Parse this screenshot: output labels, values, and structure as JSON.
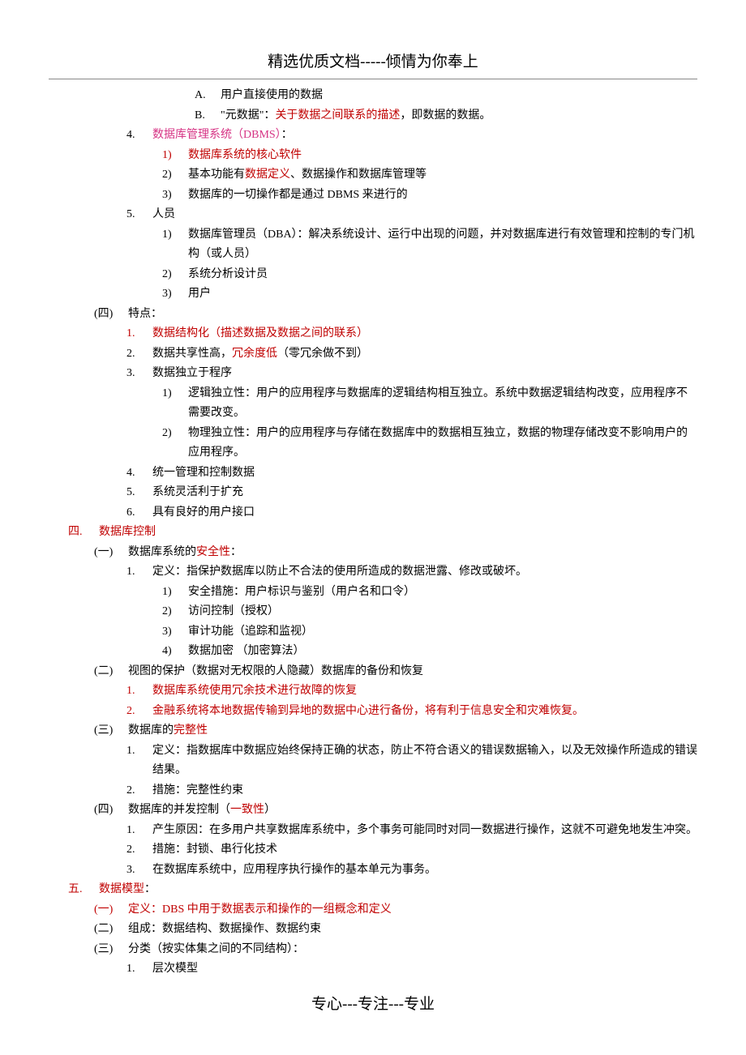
{
  "header": "精选优质文档-----倾情为你奉上",
  "footer": "专心---专注---专业",
  "lines": {
    "l1": "用户直接使用的数据",
    "l2a": "\"元数据\"：",
    "l2b": "关于数据之间联系的描述",
    "l2c": "，即数据的数据。",
    "l3a": "数据库管理系统（DBMS）",
    "l3b": "：",
    "l4": "数据库系统的核心软件",
    "l5a": "基本功能有",
    "l5b": "数据定义",
    "l5c": "、数据操作和数据库管理等",
    "l6": "数据库的一切操作都是通过 DBMS 来进行的",
    "l7": "人员",
    "l8": "数据库管理员（DBA）：解决系统设计、运行中出现的问题，并对数据库进行有效管理和控制的专门机构（或人员）",
    "l9": "系统分析设计员",
    "l10": "用户",
    "l11": "特点：",
    "l12": "数据结构化（描述数据及数据之间的联系）",
    "l13a": "数据共享性高，",
    "l13b": "冗余度低",
    "l13c": "（零冗余做不到）",
    "l14": "数据独立于程序",
    "l15": "逻辑独立性：用户的应用程序与数据库的逻辑结构相互独立。系统中数据逻辑结构改变，应用程序不需要改变。",
    "l16": "物理独立性：用户的应用程序与存储在数据库中的数据相互独立，数据的物理存储改变不影响用户的应用程序。",
    "l17": "统一管理和控制数据",
    "l18": "系统灵活利于扩充",
    "l19": "具有良好的用户接口",
    "l20": "数据库控制",
    "l21a": "数据库系统的",
    "l21b": "安全性",
    "l21c": "：",
    "l22": "定义：指保护数据库以防止不合法的使用所造成的数据泄露、修改或破坏。",
    "l23": "安全措施：用户标识与鉴别（用户名和口令）",
    "l24": "访问控制（授权）",
    "l25": "审计功能（追踪和监视）",
    "l26": "数据加密 （加密算法）",
    "l27": "视图的保护（数据对无权限的人隐藏）数据库的备份和恢复",
    "l28": "数据库系统使用冗余技术进行故障的恢复",
    "l29": "金融系统将本地数据传输到异地的数据中心进行备份，将有利于信息安全和灾难恢复。",
    "l30a": "数据库的",
    "l30b": "完整性",
    "l31": "定义：指数据库中数据应始终保持正确的状态，防止不符合语义的错误数据输入，以及无效操作所造成的错误结果。",
    "l32": "措施：完整性约束",
    "l33a": "数据库的并发控制（",
    "l33b": "一致性",
    "l33c": "）",
    "l34": "产生原因：在多用户共享数据库系统中，多个事务可能同时对同一数据进行操作，这就不可避免地发生冲突。",
    "l35": "措施：封锁、串行化技术",
    "l36": "在数据库系统中，应用程序执行操作的基本单元为事务。",
    "l37a": "数据模型",
    "l37b": "：",
    "l38": "定义：DBS 中用于数据表示和操作的一组概念和定义",
    "l39": "组成：数据结构、数据操作、数据约束",
    "l40": "分类（按实体集之间的不同结构）：",
    "l41": "层次模型"
  },
  "labels": {
    "A": "A.",
    "B": "B.",
    "n1": "1.",
    "n2": "2.",
    "n3": "3.",
    "n4": "4.",
    "n5": "5.",
    "n6": "6.",
    "p1": "1)",
    "p2": "2)",
    "p3": "3)",
    "p4": "4)",
    "cn4": "(四)",
    "cn1": "(一)",
    "cn2": "(二)",
    "cn3": "(三)",
    "roman4": "四.",
    "roman5": "五."
  }
}
